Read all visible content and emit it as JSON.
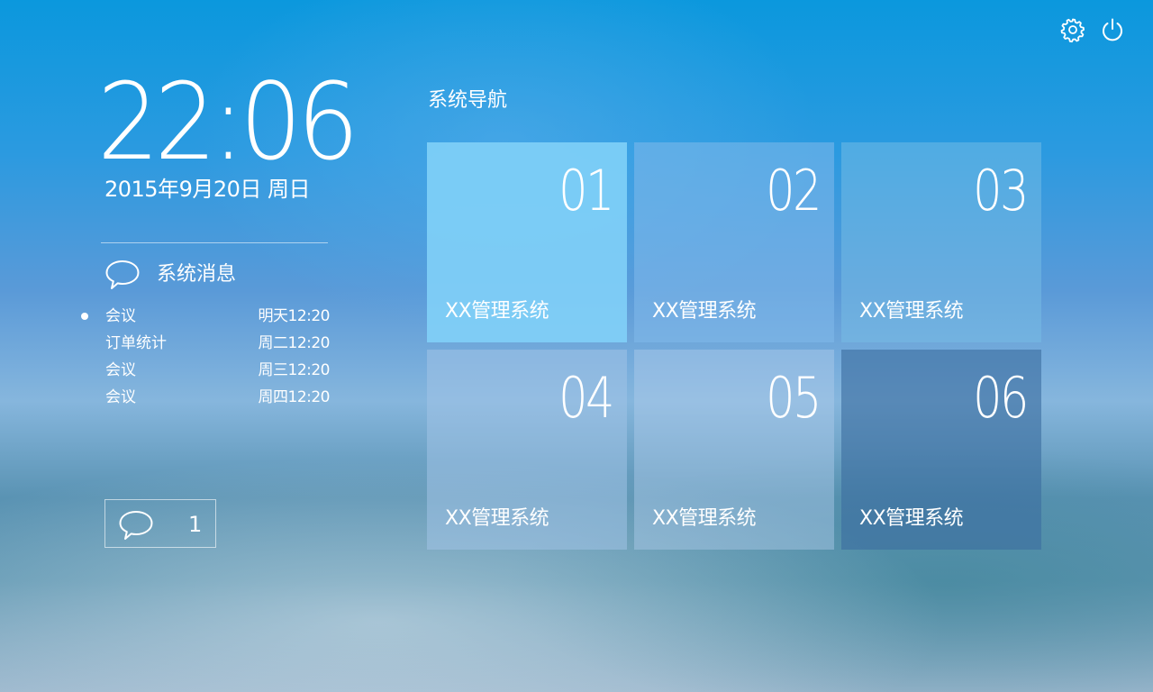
{
  "header": {
    "icons": [
      "gear-icon",
      "power-icon"
    ]
  },
  "clock": {
    "time": "22:06",
    "date": "2015年9月20日  周日"
  },
  "messages": {
    "title": "系统消息",
    "icon": "chat-bubble-icon",
    "items": [
      {
        "label": "会议",
        "time": "明天12:20",
        "unread": true
      },
      {
        "label": "订单统计",
        "time": "周二12:20",
        "unread": false
      },
      {
        "label": "会议",
        "time": "周三12:20",
        "unread": false
      },
      {
        "label": "会议",
        "time": "周四12:20",
        "unread": false
      }
    ]
  },
  "counter": {
    "icon": "chat-bubble-icon",
    "count": "1"
  },
  "nav": {
    "title": "系统导航",
    "tiles": [
      {
        "number": "01",
        "label": "XX管理系统"
      },
      {
        "number": "02",
        "label": "XX管理系统"
      },
      {
        "number": "03",
        "label": "XX管理系统"
      },
      {
        "number": "04",
        "label": "XX管理系统"
      },
      {
        "number": "05",
        "label": "XX管理系统"
      },
      {
        "number": "06",
        "label": "XX管理系统"
      }
    ]
  },
  "colors": {
    "background_top": "#0b98dd",
    "background_mid": "#86b6dd",
    "text": "#ffffff",
    "tile_highlight": "#82d2f8",
    "tile_dark": "#3c6ea0"
  }
}
